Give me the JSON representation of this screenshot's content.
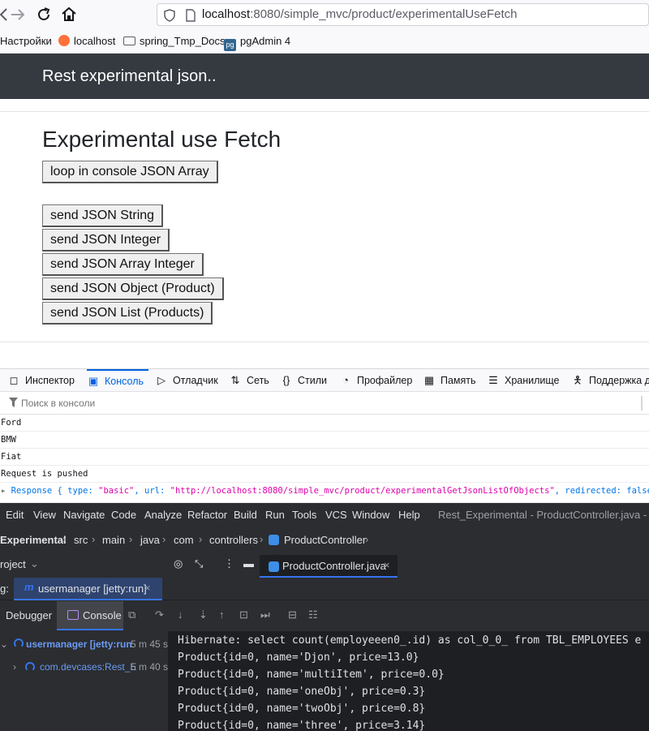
{
  "browser": {
    "url_host": "localhost",
    "url_rest": ":8080/simple_mvc/product/experimentalUseFetch",
    "bookmarks": [
      "Настройки",
      "localhost",
      "spring_Tmp_Docs",
      "pgAdmin 4"
    ]
  },
  "page": {
    "navbar_brand": "Rest experimental json..",
    "title": "Experimental use Fetch",
    "buttons": [
      "loop in console JSON Array",
      "send JSON String",
      "send JSON Integer",
      "send JSON Array Integer",
      "send JSON Object (Product)",
      "send JSON List (Products)"
    ]
  },
  "devtools": {
    "tabs": [
      "Инспектор",
      "Консоль",
      "Отладчик",
      "Сеть",
      "Стили",
      "Профайлер",
      "Память",
      "Хранилище",
      "Поддержка до"
    ],
    "active_tab": "Консоль",
    "filter_placeholder": "Поиск в консоли",
    "log": [
      "Ford",
      "BMW",
      "Fiat",
      "Request is pushed"
    ],
    "response_prefix": "Response { type: ",
    "response_type": "\"basic\"",
    "response_mid": ", url: ",
    "response_url": "\"http://localhost:8080/simple_mvc/product/experimentalGetJsonListOfObjects\"",
    "response_tail": ", redirected: false, stat"
  },
  "ide": {
    "menu": [
      "Edit",
      "View",
      "Navigate",
      "Code",
      "Analyze",
      "Refactor",
      "Build",
      "Run",
      "Tools",
      "VCS",
      "Window",
      "Help"
    ],
    "window_title": "Rest_Experimental - ProductController.java - Adm",
    "breadcrumbs": [
      "Experimental",
      "src",
      "main",
      "java",
      "com",
      "controllers",
      "ProductController"
    ],
    "project_label": "roject",
    "editor_tab": "ProductController.java",
    "run_prefix": "g:",
    "run_tab": "usermanager [jetty:run]",
    "debugger_tab": "Debugger",
    "console_tab": "Console",
    "tree": [
      {
        "name": "usermanager [jetty:run",
        "time": "5 m 45 s"
      },
      {
        "name": "com.devcases:Rest_E",
        "time": "5 m 40 s"
      }
    ],
    "output": [
      "Hibernate: select count(employeeen0_.id) as col_0_0_ from TBL_EMPLOYEES e",
      "Product{id=0, name='Djon', price=13.0}",
      "Product{id=0, name='multiItem', price=0.0}",
      "Product{id=0, name='oneObj', price=0.3}",
      "Product{id=0, name='twoObj', price=0.8}",
      "Product{id=0, name='three', price=3.14}"
    ]
  },
  "colors": {
    "navbar": "#343a40",
    "devtools_accent": "#0061e0",
    "ide_bg": "#2b2d30",
    "ide_console_bg": "#1e1f22",
    "ide_accent": "#3574f0"
  }
}
